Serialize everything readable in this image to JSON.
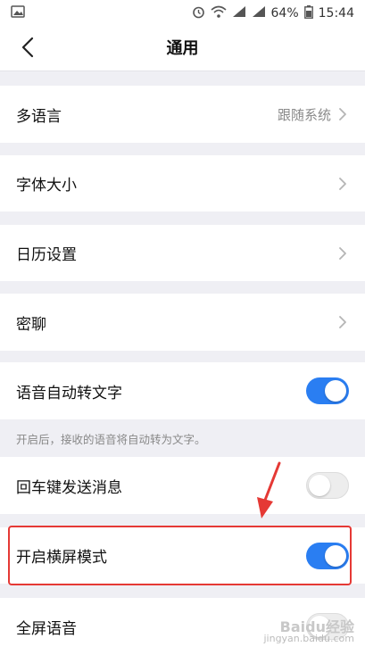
{
  "status_bar": {
    "battery": "64%",
    "time": "15:44",
    "icons": [
      "image-icon",
      "alarm-icon",
      "wifi-icon",
      "signal-icon",
      "signal-icon",
      "battery-icon"
    ]
  },
  "nav": {
    "title": "通用",
    "back_icon": "chevron-left-icon"
  },
  "rows": {
    "language": {
      "label": "多语言",
      "value": "跟随系统"
    },
    "font_size": {
      "label": "字体大小"
    },
    "calendar": {
      "label": "日历设置"
    },
    "secret_chat": {
      "label": "密聊"
    },
    "voice_to_text": {
      "label": "语音自动转文字",
      "on": true
    },
    "voice_hint": "开启后，接收的语音将自动转为文字。",
    "enter_send": {
      "label": "回车键发送消息",
      "on": false
    },
    "landscape": {
      "label": "开启横屏模式",
      "on": true
    },
    "fullscreen_voice": {
      "label": "全屏语音",
      "on": false
    }
  },
  "watermark": {
    "brand": "Baidu经验",
    "url": "jingyan.baidu.com"
  },
  "colors": {
    "accent": "#2a7ef2",
    "highlight": "#e53935",
    "annotation_arrow": "#e53935",
    "background": "#efeff4"
  }
}
